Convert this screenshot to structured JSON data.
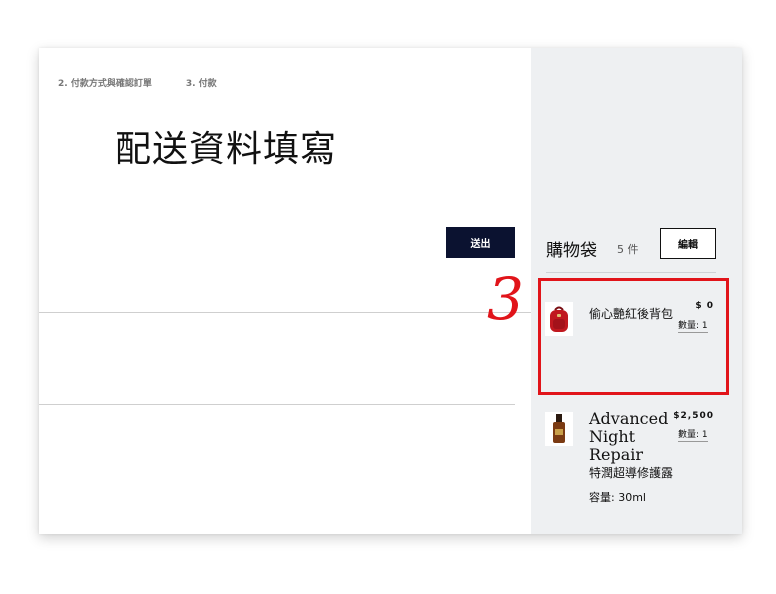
{
  "steps": [
    "2. 付款方式與確認訂單",
    "3. 付款"
  ],
  "page_title": "配送資料填寫",
  "submit_label": "送出",
  "bag": {
    "title": "購物袋",
    "count": "5 件",
    "edit_label": "編輯"
  },
  "items": [
    {
      "name": "偷心艷紅後背包",
      "price": "$ 0",
      "qty": "數量: 1",
      "thumb_icon": "red-backpack-icon"
    },
    {
      "name": "Advanced Night Repair",
      "subtitle": "特潤超導修護露",
      "capacity": "容量: 30ml",
      "price": "$2,500",
      "qty": "數量: 1",
      "thumb_icon": "serum-bottle-icon"
    }
  ],
  "annotation": {
    "number": "3",
    "color": "#e1141a"
  },
  "colors": {
    "submit_bg": "#0b1230",
    "sidebar_bg": "#eef0f2"
  }
}
